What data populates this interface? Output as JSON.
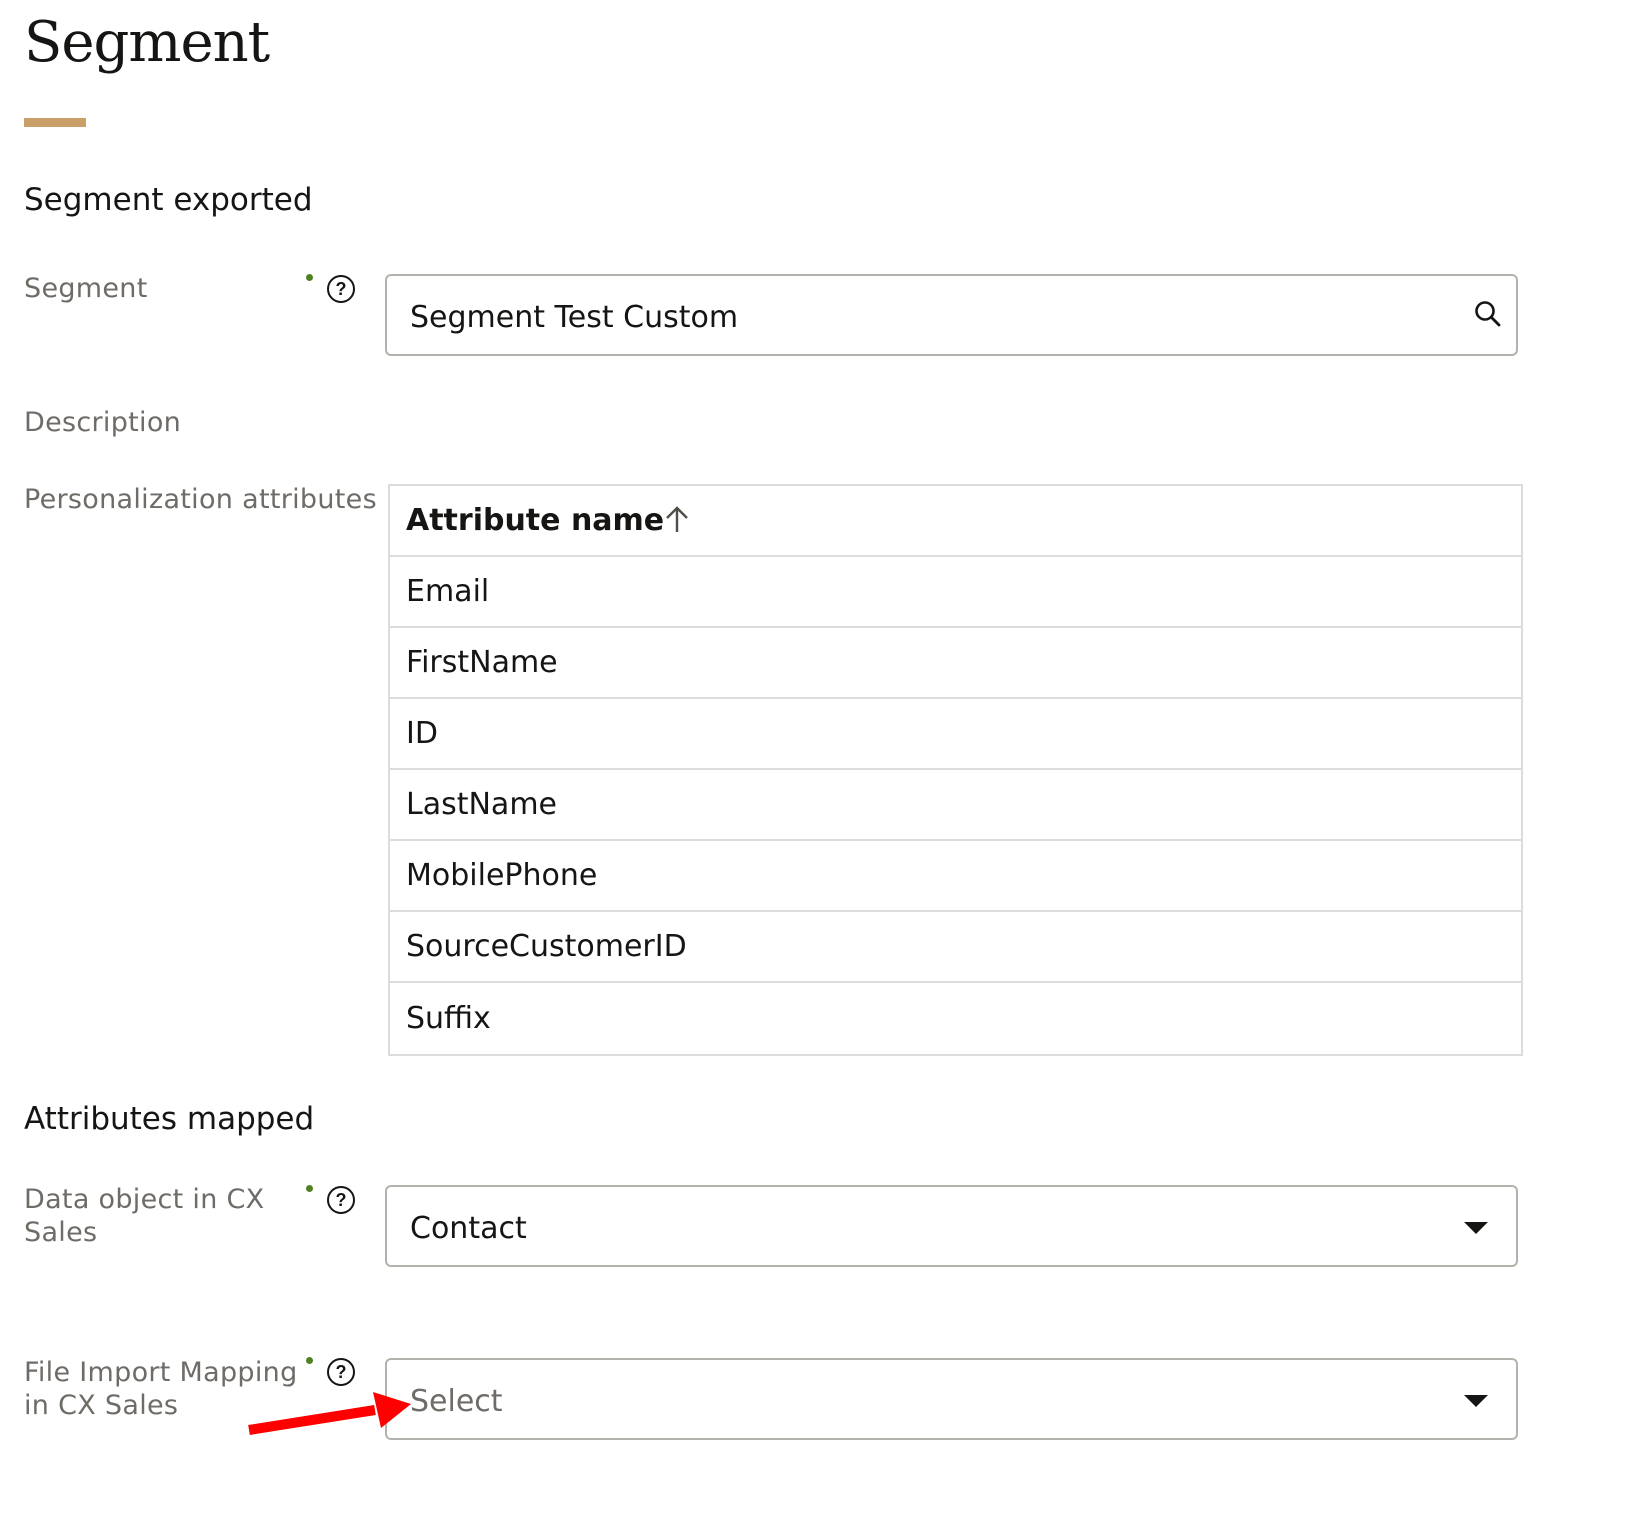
{
  "page": {
    "title": "Segment"
  },
  "sections": {
    "segment_exported": "Segment exported",
    "attributes_mapped": "Attributes mapped"
  },
  "fields": {
    "segment": {
      "label": "Segment",
      "value": "Segment Test Custom",
      "required": true,
      "help": "?"
    },
    "description": {
      "label": "Description"
    },
    "personalization": {
      "label": "Personalization attributes"
    },
    "data_object": {
      "label": "Data object in CX Sales",
      "value": "Contact",
      "required": true,
      "help": "?"
    },
    "file_import_mapping": {
      "label": "File Import Mapping in CX Sales",
      "placeholder": "Select",
      "required": true,
      "help": "?"
    }
  },
  "attributes_table": {
    "header": "Attribute name",
    "sort": "ascending",
    "rows": [
      "Email",
      "FirstName",
      "ID",
      "LastName",
      "MobilePhone",
      "SourceCustomerID",
      "Suffix"
    ]
  },
  "colors": {
    "accent": "#c9a06a",
    "required_dot": "#508223",
    "annotation_arrow": "#ff0000"
  },
  "icons": {
    "search": "search-icon",
    "dropdown": "caret-down-icon",
    "help": "help-icon",
    "sort": "arrow-up-icon"
  }
}
